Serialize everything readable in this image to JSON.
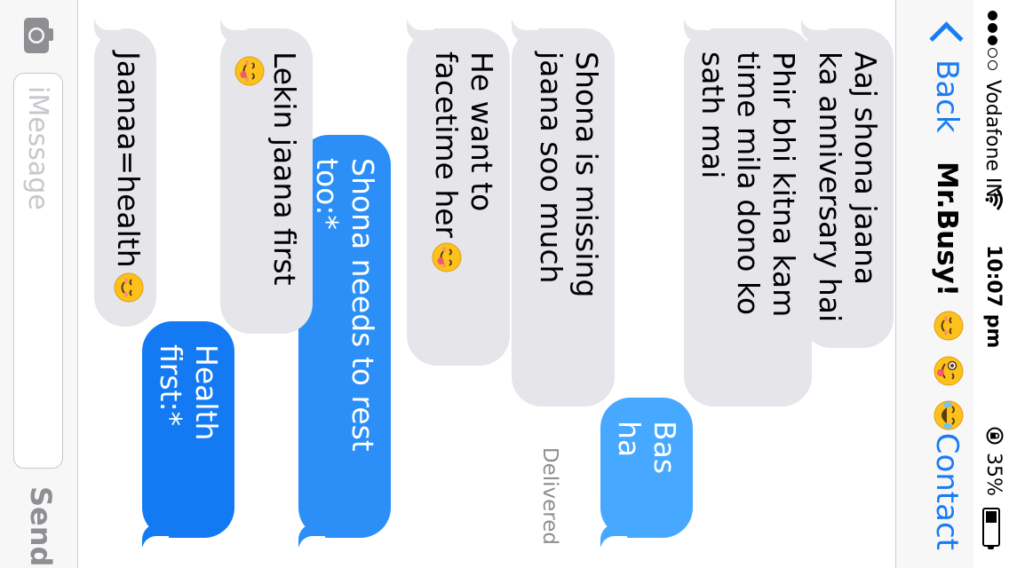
{
  "status_bar": {
    "carrier": "Vodafone IN",
    "time": "10:07 pm",
    "battery_percent_text": "35%",
    "battery_level": 0.35,
    "signal_bars": 3,
    "signal_max": 5
  },
  "nav": {
    "back_label": "Back",
    "title": "Mr.Busy!",
    "title_emojis": [
      "relieved-face-emoji",
      "winking-tongue-face-emoji",
      "tears-of-joy-face-emoji"
    ],
    "contact_label": "Contact"
  },
  "messages": [
    {
      "direction": "in",
      "text": "Aaj shona jaana ka anniversary hai"
    },
    {
      "direction": "in",
      "text": "Phir bhi kitna kam time mila dono ko sath mai"
    },
    {
      "direction": "out",
      "text": "Bas ha"
    },
    {
      "direction": "in",
      "text": "Shona is missing jaana soo much"
    },
    {
      "direction": "in",
      "text": "He want to facetime her",
      "emoji": "yum-face-emoji"
    },
    {
      "direction": "out",
      "text": "Shona needs to rest too:*"
    },
    {
      "direction": "in",
      "text": "Lekin jaana first",
      "emoji": "yum-face-emoji"
    },
    {
      "direction": "out",
      "text": "Health first:*"
    },
    {
      "direction": "in",
      "text": "Jaanaa=health",
      "emoji": "relieved-face-emoji"
    }
  ],
  "delivered_label": "Delivered",
  "input": {
    "placeholder": "iMessage",
    "send_label": "Send"
  },
  "colors": {
    "accent": "#1a7cf5",
    "incoming_bubble": "#e5e5ea",
    "outgoing_bubble_light": "#46a8ff",
    "outgoing_bubble_dark": "#137af4",
    "meta_gray": "#8e8e93"
  }
}
